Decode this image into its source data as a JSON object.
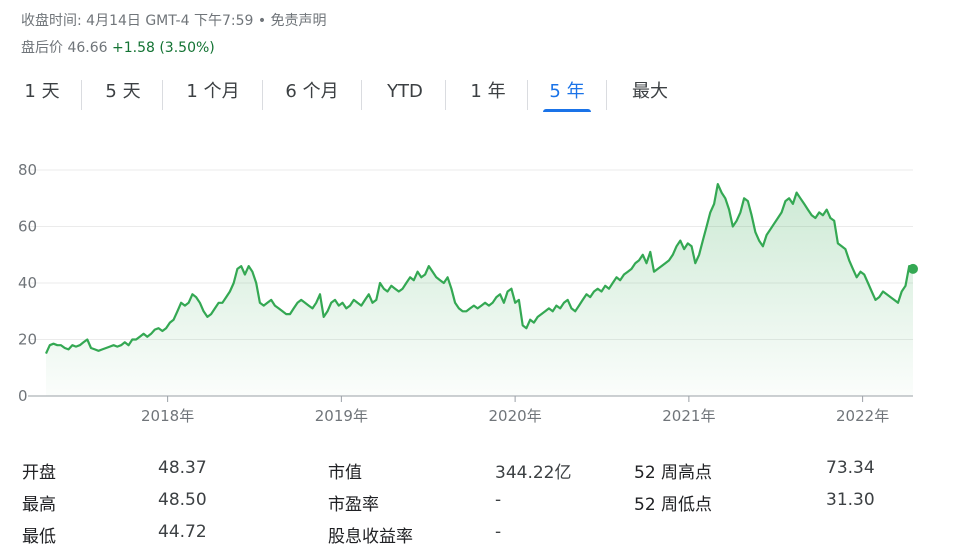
{
  "header": {
    "close_text": "收盘时间: 4月14日 GMT-4 下午7:59 • 免责声明",
    "after_label": "盘后价 46.66",
    "after_change": "+1.58 (3.50%)"
  },
  "tabs": [
    {
      "label": "1 天",
      "active": false
    },
    {
      "label": "5 天",
      "active": false
    },
    {
      "label": "1 个月",
      "active": false
    },
    {
      "label": "6 个月",
      "active": false
    },
    {
      "label": "YTD",
      "active": false
    },
    {
      "label": "1 年",
      "active": false
    },
    {
      "label": "5 年",
      "active": true
    },
    {
      "label": "最大",
      "active": false
    }
  ],
  "chart_data": {
    "type": "area",
    "x_start": 2017.3,
    "x_end": 2022.29,
    "ylim": [
      0,
      80
    ],
    "yticks": [
      "0",
      "20",
      "40",
      "60",
      "80"
    ],
    "xticks": [
      {
        "label": "2018年",
        "x": 2018.0
      },
      {
        "label": "2019年",
        "x": 2019.0
      },
      {
        "label": "2020年",
        "x": 2020.0
      },
      {
        "label": "2021年",
        "x": 2021.0
      },
      {
        "label": "2022年",
        "x": 2022.0
      }
    ],
    "line_color": "#34a853",
    "grid": true,
    "series": [
      {
        "values": [
          15,
          18,
          18.5,
          18,
          18,
          17,
          16.5,
          18,
          17.5,
          18,
          19,
          20,
          17,
          16.5,
          16,
          16.5,
          17,
          17.5,
          18,
          17.5,
          18,
          19,
          18,
          20,
          20,
          21,
          22,
          21,
          22,
          23.5,
          24,
          23,
          24,
          26,
          27,
          30,
          33,
          32,
          33,
          36,
          35,
          33,
          30,
          28,
          29,
          31,
          33,
          33,
          35,
          37,
          40,
          45,
          46,
          43,
          46,
          44,
          40,
          33,
          32,
          33,
          34,
          32,
          31,
          30,
          29,
          29,
          31,
          33,
          34,
          33,
          32,
          31,
          33,
          36,
          28,
          30,
          33,
          34,
          32,
          33,
          31,
          32,
          34,
          33,
          32,
          34,
          36,
          33,
          34,
          40,
          38,
          37,
          39,
          38,
          37,
          38,
          40,
          42,
          41,
          44,
          42,
          43,
          46,
          44,
          42,
          41,
          40,
          42,
          38,
          33,
          31,
          30,
          30,
          31,
          32,
          31,
          32,
          33,
          32,
          33,
          35,
          36,
          33,
          37,
          38,
          33,
          34,
          25,
          24,
          27,
          26,
          28,
          29,
          30,
          31,
          30,
          32,
          31,
          33,
          34,
          31,
          30,
          32,
          34,
          36,
          35,
          37,
          38,
          37,
          39,
          38,
          40,
          42,
          41,
          43,
          44,
          45,
          47,
          48,
          50,
          47,
          51,
          44,
          45,
          46,
          47,
          48,
          50,
          53,
          55,
          52,
          54,
          53,
          47,
          50,
          55,
          60,
          65,
          68,
          75,
          72,
          70,
          66,
          60,
          62,
          65,
          70,
          69,
          64,
          58,
          55,
          53,
          57,
          59,
          61,
          63,
          65,
          69,
          70,
          68,
          72,
          70,
          68,
          66,
          64,
          63,
          65,
          64,
          66,
          63,
          62,
          54,
          53,
          52,
          48,
          45,
          42,
          44,
          43,
          40,
          37,
          34,
          35,
          37,
          36,
          35,
          34,
          33,
          37,
          39,
          46,
          45
        ]
      }
    ],
    "last_point": {
      "x": 2022.29,
      "y": 45
    }
  },
  "stats": [
    {
      "label": "开盘",
      "value": "48.37"
    },
    {
      "label": "最高",
      "value": "48.50"
    },
    {
      "label": "最低",
      "value": "44.72"
    },
    {
      "label": "市值",
      "value": "344.22亿"
    },
    {
      "label": "市盈率",
      "value": "-"
    },
    {
      "label": "股息收益率",
      "value": "-"
    },
    {
      "label": "52 周高点",
      "value": "73.34"
    },
    {
      "label": "52 周低点",
      "value": "31.30"
    }
  ]
}
